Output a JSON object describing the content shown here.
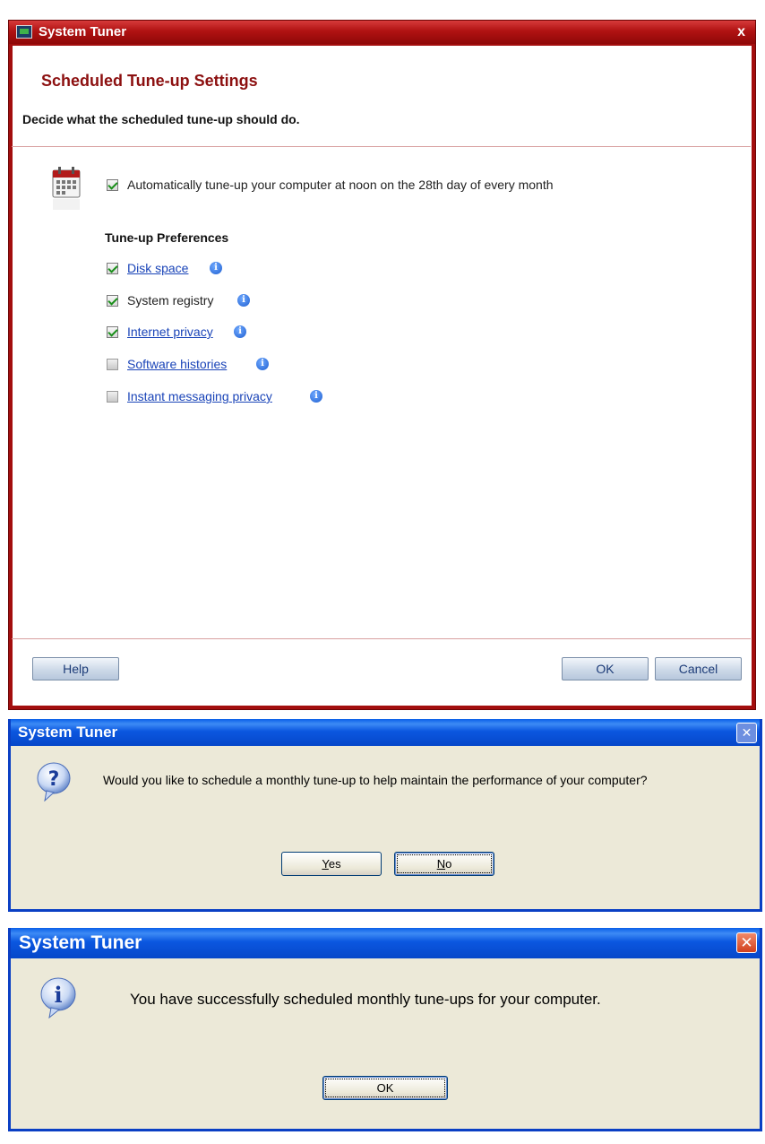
{
  "dialog1": {
    "title": "System Tuner",
    "close": "x",
    "heading": "Scheduled Tune-up Settings",
    "subtitle": "Decide what the scheduled tune-up should do.",
    "auto_option": {
      "label": "Automatically tune-up your computer at noon on the 28th day of every month",
      "checked": true
    },
    "prefs_title": "Tune-up Preferences",
    "preferences": [
      {
        "label": "Disk space",
        "checked": true,
        "link": true
      },
      {
        "label": "System registry",
        "checked": true,
        "link": false
      },
      {
        "label": "Internet privacy",
        "checked": true,
        "link": true
      },
      {
        "label": "Software histories",
        "checked": false,
        "link": true
      },
      {
        "label": "Instant messaging privacy",
        "checked": false,
        "link": true
      }
    ],
    "help_button": "Help",
    "ok_button": "OK",
    "cancel_button": "Cancel",
    "icons": [
      "app-icon",
      "calendar-icon",
      "info-icon"
    ]
  },
  "dialog2": {
    "title": "System Tuner",
    "close": "✕",
    "message": "Would you like to schedule a monthly tune-up to help maintain the performance of your computer?",
    "yes_button": {
      "accel": "Y",
      "rest": "es"
    },
    "no_button": {
      "accel": "N",
      "rest": "o"
    },
    "icon": "question-icon"
  },
  "dialog3": {
    "title": "System Tuner",
    "close": "✕",
    "message": "You have successfully scheduled monthly tune-ups for your computer.",
    "ok_button": "OK",
    "icon": "info-icon"
  },
  "colors": {
    "dialog1_accent": "#a30e0e",
    "heading_red": "#8c1010",
    "link_blue": "#1a44b8",
    "xp_title_blue": "#0647c9",
    "xp_face": "#ece9d8"
  }
}
